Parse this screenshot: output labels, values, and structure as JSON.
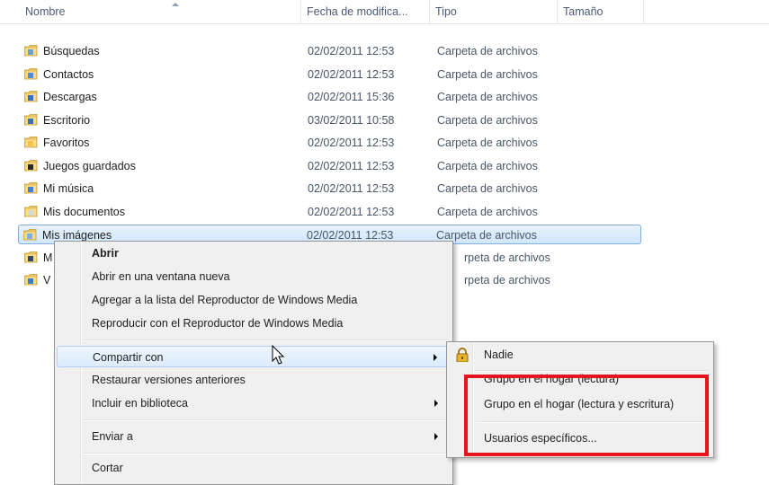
{
  "columns": {
    "name": "Nombre",
    "date": "Fecha de modifica...",
    "type": "Tipo",
    "size": "Tamaño"
  },
  "files": [
    {
      "name": "Búsquedas",
      "date": "02/02/2011 12:53",
      "type": "Carpeta de archivos",
      "icon": "searches-folder-icon"
    },
    {
      "name": "Contactos",
      "date": "02/02/2011 12:53",
      "type": "Carpeta de archivos",
      "icon": "contacts-folder-icon"
    },
    {
      "name": "Descargas",
      "date": "02/02/2011 15:36",
      "type": "Carpeta de archivos",
      "icon": "downloads-folder-icon"
    },
    {
      "name": "Escritorio",
      "date": "03/02/2011 10:58",
      "type": "Carpeta de archivos",
      "icon": "desktop-folder-icon"
    },
    {
      "name": "Favoritos",
      "date": "02/02/2011 12:53",
      "type": "Carpeta de archivos",
      "icon": "favorites-folder-icon"
    },
    {
      "name": "Juegos guardados",
      "date": "02/02/2011 12:53",
      "type": "Carpeta de archivos",
      "icon": "saved-games-folder-icon"
    },
    {
      "name": "Mi música",
      "date": "02/02/2011 12:53",
      "type": "Carpeta de archivos",
      "icon": "music-folder-icon"
    },
    {
      "name": "Mis documentos",
      "date": "02/02/2011 12:53",
      "type": "Carpeta de archivos",
      "icon": "documents-folder-icon"
    },
    {
      "name": "Mis imágenes",
      "date": "02/02/2011 12:53",
      "type": "Carpeta de archivos",
      "icon": "pictures-folder-icon",
      "selected": true
    },
    {
      "name": "M",
      "date": "",
      "type": "rpeta de archivos",
      "icon": "videos-folder-icon"
    },
    {
      "name": "V",
      "date": "",
      "type": "rpeta de archivos",
      "icon": "links-folder-icon"
    }
  ],
  "context_menu": {
    "items": [
      {
        "label": "Abrir",
        "bold": true
      },
      {
        "label": "Abrir en una ventana nueva"
      },
      {
        "label": "Agregar a la lista del Reproductor de Windows Media"
      },
      {
        "label": "Reproducir con el Reproductor de Windows Media"
      },
      {
        "label": "Compartir con",
        "submenu": true,
        "hover": true
      },
      {
        "label": "Restaurar versiones anteriores"
      },
      {
        "label": "Incluir en biblioteca",
        "submenu": true
      },
      {
        "label": "Enviar a",
        "submenu": true
      },
      {
        "label": "Cortar"
      }
    ]
  },
  "share_submenu": {
    "items": [
      {
        "label": "Nadie",
        "icon": "lock-icon"
      },
      {
        "label": "Grupo en el hogar (lectura)"
      },
      {
        "label": "Grupo en el hogar (lectura y escritura)"
      },
      {
        "label": "Usuarios específicos..."
      }
    ]
  },
  "colors": {
    "highlight": "#e8141b",
    "selection_border": "#84acdd",
    "menu_bg": "#f0f0f0"
  }
}
